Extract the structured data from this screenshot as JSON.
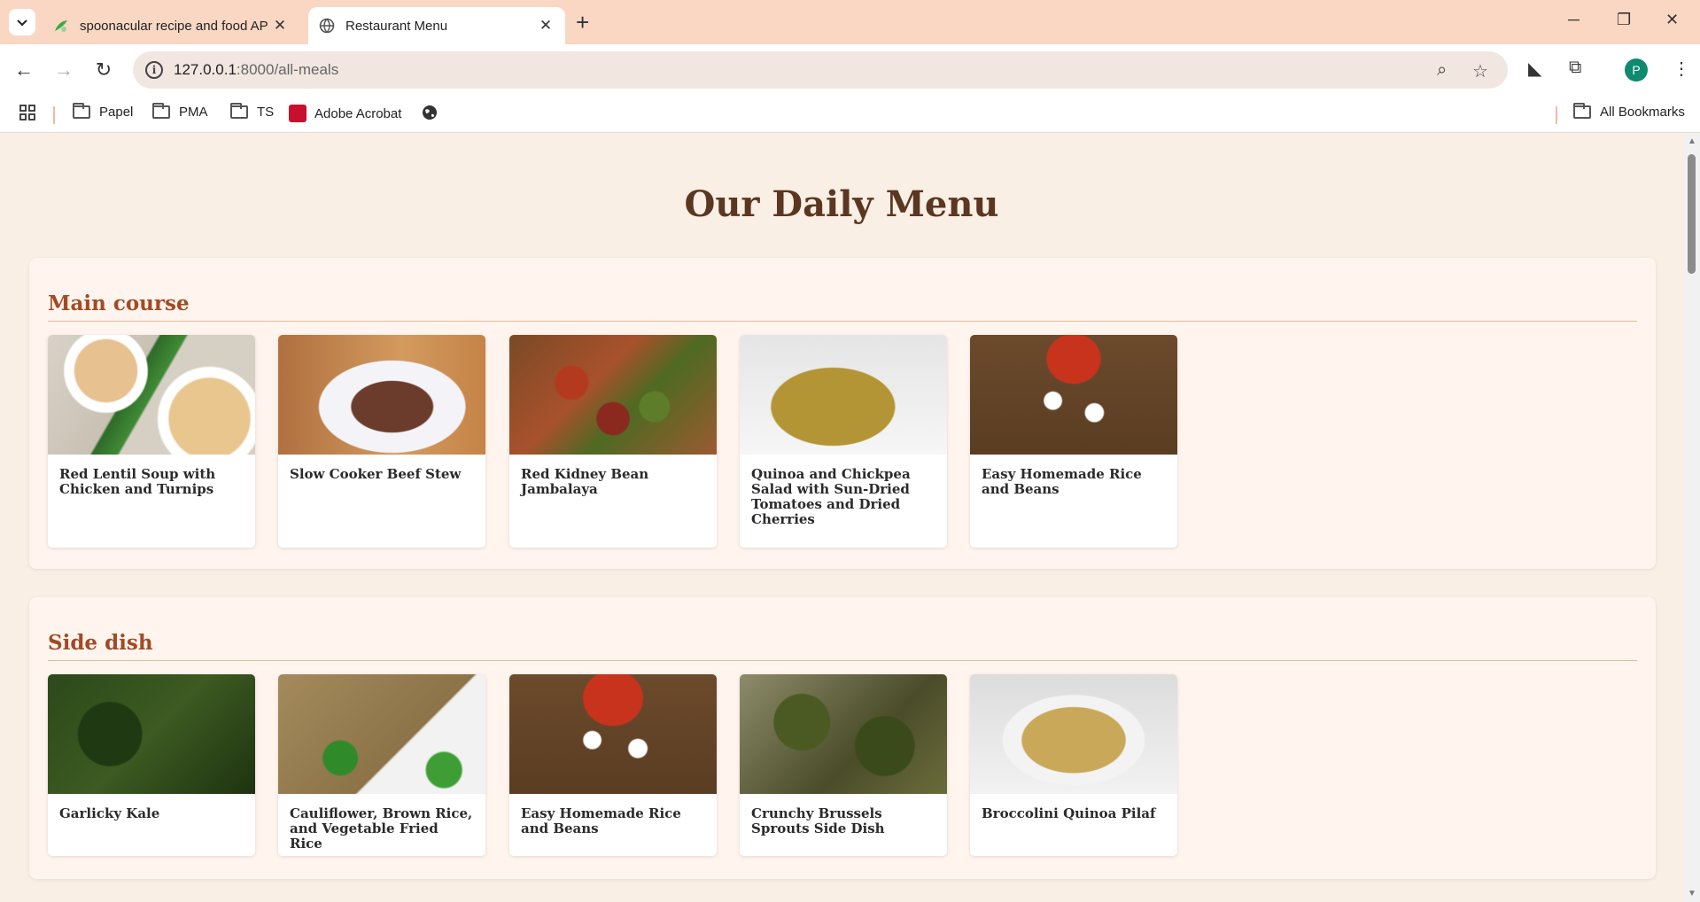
{
  "browser": {
    "tabs": [
      {
        "title": "spoonacular recipe and food AP",
        "active": false
      },
      {
        "title": "Restaurant Menu",
        "active": true
      }
    ],
    "url_host": "127.0.0.1",
    "url_path": ":8000/all-meals",
    "profile_initial": "P",
    "bookmarks": [
      "Papel",
      "PMA",
      "TS",
      "Adobe Acrobat"
    ],
    "all_bookmarks": "All Bookmarks"
  },
  "page": {
    "title": "Our Daily Menu",
    "sections": [
      {
        "title": "Main course",
        "items": [
          "Red Lentil Soup with Chicken and Turnips",
          "Slow Cooker Beef Stew",
          "Red Kidney Bean Jambalaya",
          "Quinoa and Chickpea Salad with Sun-Dried Tomatoes and Dried Cherries",
          "Easy Homemade Rice and Beans"
        ]
      },
      {
        "title": "Side dish",
        "items": [
          "Garlicky Kale",
          "Cauliflower, Brown Rice, and Vegetable Fried Rice",
          "Easy Homemade Rice and Beans",
          "Crunchy Brussels Sprouts Side Dish",
          "Broccolini Quinoa Pilaf"
        ]
      }
    ]
  }
}
